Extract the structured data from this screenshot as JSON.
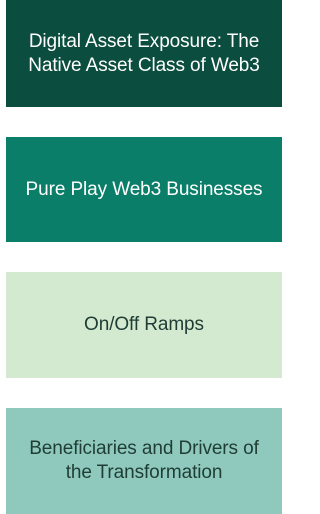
{
  "blocks": [
    {
      "label": "Digital Asset Exposure: The Native Asset Class of Web3",
      "background": "#0b4d3e",
      "text_color": "#ffffff"
    },
    {
      "label": "Pure Play Web3 Businesses",
      "background": "#0a7e68",
      "text_color": "#ffffff"
    },
    {
      "label": "On/Off Ramps",
      "background": "#d3ead0",
      "text_color": "#1f3d35"
    },
    {
      "label": "Beneficiaries and Drivers of the Transformation",
      "background": "#8fc9bd",
      "text_color": "#1f3d35"
    }
  ]
}
